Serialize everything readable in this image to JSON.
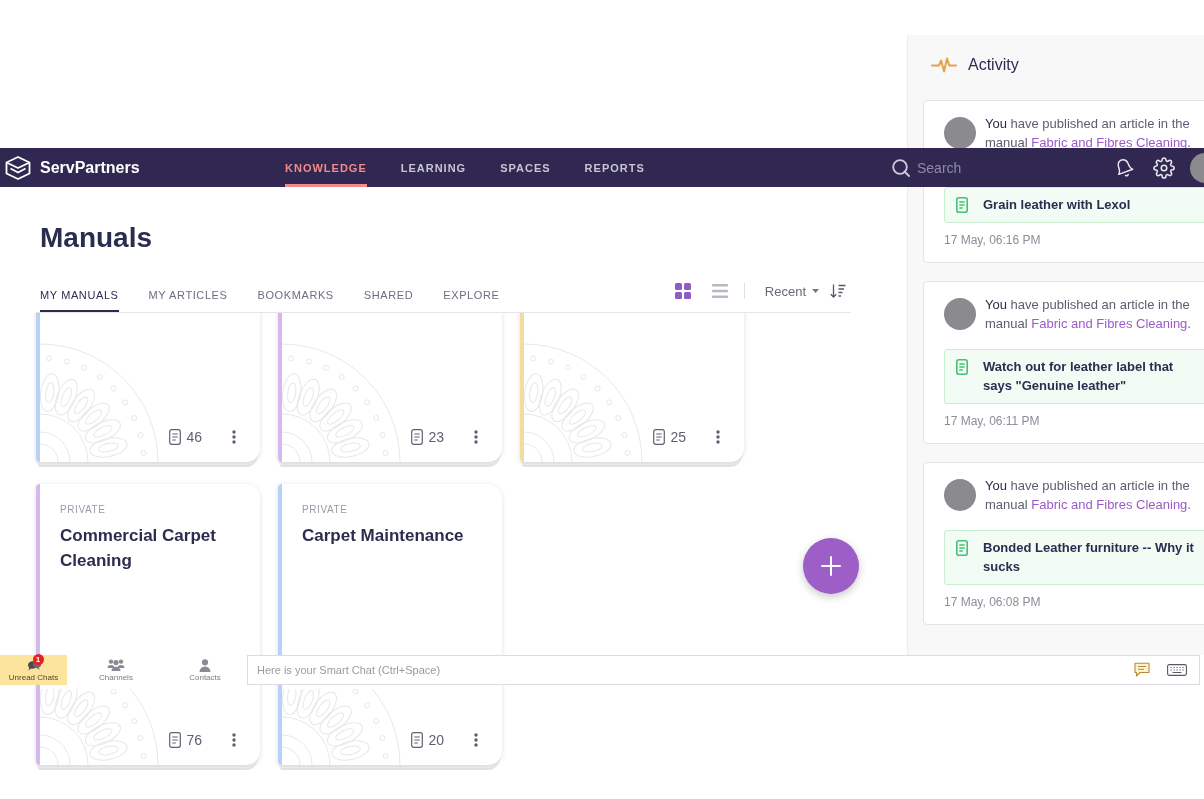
{
  "brand": {
    "name": "ServPartners"
  },
  "nav": {
    "items": [
      {
        "label": "KNOWLEDGE",
        "selected": true
      },
      {
        "label": "LEARNING",
        "selected": false
      },
      {
        "label": "SPACES",
        "selected": false
      },
      {
        "label": "REPORTS",
        "selected": false
      }
    ],
    "search": {
      "placeholder": "Search"
    }
  },
  "page": {
    "title": "Manuals"
  },
  "tabs": [
    {
      "label": "MY MANUALS",
      "selected": true
    },
    {
      "label": "MY ARTICLES",
      "selected": false
    },
    {
      "label": "BOOKMARKS",
      "selected": false
    },
    {
      "label": "SHARED",
      "selected": false
    },
    {
      "label": "EXPLORE",
      "selected": false
    }
  ],
  "toolbar": {
    "views": [
      {
        "kind": "grid",
        "selected": true
      },
      {
        "kind": "list",
        "selected": false
      }
    ],
    "sort": {
      "label": "Recent"
    }
  },
  "manuals": [
    {
      "color": "#b9d1f6",
      "count": "46"
    },
    {
      "color": "#d5b8ee",
      "count": "23"
    },
    {
      "color": "#f2dca0",
      "count": "25"
    },
    {
      "label": "PRIVATE",
      "title": "Commercial Carpet Cleaning",
      "color": "#d5b8ee",
      "count": "76"
    },
    {
      "label": "PRIVATE",
      "title": "Carpet Maintenance",
      "color": "#b9d1f6",
      "count": "20"
    }
  ],
  "activity": {
    "title": "Activity",
    "items": [
      {
        "text": "**You** have published an article in the manual",
        "link": "Fabric and Fibres Cleaning",
        "after_link": ".",
        "article": "Grain leather with Lexol",
        "time": "17 May, 06:16 PM"
      },
      {
        "text": "**You** have published an article in the manual",
        "link": "Fabric and Fibres Cleaning",
        "after_link": ".",
        "article": "Watch out for leather label that says \"Genuine leather\"",
        "time": "17 May, 06:11 PM"
      },
      {
        "text": "**You** have published an article in the manual",
        "link": "Fabric and Fibres Cleaning",
        "after_link": ".",
        "article": "Bonded Leather furniture -- Why it sucks",
        "time": "17 May, 06:08 PM"
      }
    ]
  },
  "chat": {
    "tabs": [
      {
        "kind": "unread",
        "label": "Unread Chats",
        "selected": true,
        "badge": "1"
      },
      {
        "kind": "channels",
        "label": "Channels",
        "selected": false
      },
      {
        "kind": "contacts",
        "label": "Contacts",
        "selected": false
      }
    ],
    "placeholder": "Here is your Smart Chat (Ctrl+Space)"
  }
}
